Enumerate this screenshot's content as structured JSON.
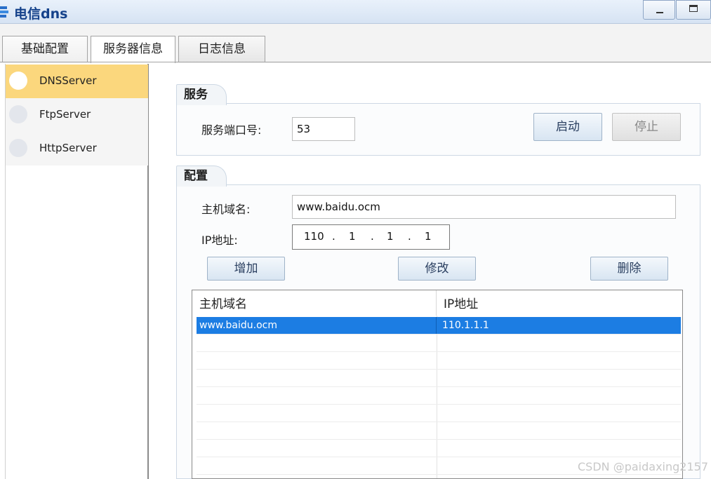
{
  "window": {
    "title": "电信dns"
  },
  "tabs": [
    {
      "label": "基础配置"
    },
    {
      "label": "服务器信息"
    },
    {
      "label": "日志信息"
    }
  ],
  "sidebar": {
    "items": [
      {
        "label": "DNSServer",
        "active": true
      },
      {
        "label": "FtpServer",
        "active": false
      },
      {
        "label": "HttpServer",
        "active": false
      }
    ]
  },
  "service": {
    "group_title": "服务",
    "port_label": "服务端口号:",
    "port_value": "53",
    "start_label": "启动",
    "stop_label": "停止"
  },
  "config": {
    "group_title": "配置",
    "host_label": "主机域名:",
    "host_value": "www.baidu.ocm",
    "ip_label": "IP地址:",
    "ip_octets": [
      "110",
      "1",
      "1",
      "1"
    ],
    "ip_dot": ".",
    "add_label": "增加",
    "modify_label": "修改",
    "delete_label": "删除"
  },
  "table": {
    "columns": [
      "主机域名",
      "IP地址"
    ],
    "rows": [
      {
        "host": "www.baidu.ocm",
        "ip": "110.1.1.1",
        "selected": true
      }
    ]
  },
  "watermark": "CSDN @paidaxing2157",
  "colors": {
    "accent": "#1c7de3",
    "nav_active": "#fbd77d",
    "title_text": "#15428b"
  }
}
